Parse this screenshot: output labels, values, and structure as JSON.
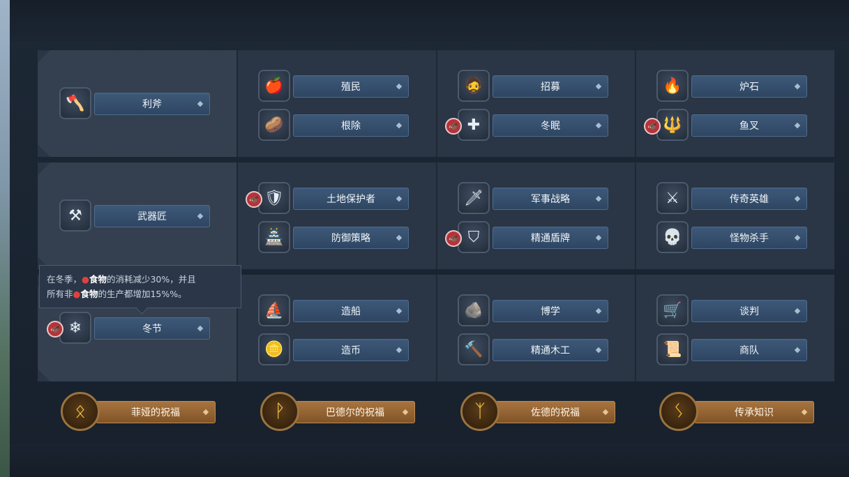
{
  "rows": [
    {
      "left": {
        "icon": "axe-icon",
        "glyph": "🪓",
        "label": "利斧",
        "badge": false
      },
      "cols": [
        [
          {
            "icon": "colonist-icon",
            "glyph": "🍎",
            "label": "殖民",
            "badge": false
          },
          {
            "icon": "uproot-icon",
            "glyph": "🥔",
            "label": "根除",
            "badge": false
          }
        ],
        [
          {
            "icon": "recruit-icon",
            "glyph": "🧔",
            "label": "招募",
            "badge": false
          },
          {
            "icon": "hibernate-icon",
            "glyph": "✚",
            "label": "冬眠",
            "badge": true
          }
        ],
        [
          {
            "icon": "hearth-icon",
            "glyph": "🔥",
            "label": "炉石",
            "badge": false
          },
          {
            "icon": "harpoon-icon",
            "glyph": "🔱",
            "label": "鱼叉",
            "badge": true
          }
        ]
      ]
    },
    {
      "left": {
        "icon": "anvil-icon",
        "glyph": "⚒",
        "label": "武器匠",
        "badge": false
      },
      "cols": [
        [
          {
            "icon": "shield-emblem-icon",
            "glyph": "🛡",
            "label": "土地保护者",
            "badge": true
          },
          {
            "icon": "watchtower-icon",
            "glyph": "🏯",
            "label": "防御策略",
            "badge": false
          }
        ],
        [
          {
            "icon": "sword-icon",
            "glyph": "🗡",
            "label": "军事战略",
            "badge": false
          },
          {
            "icon": "round-shield-icon",
            "glyph": "⛉",
            "label": "精通盾牌",
            "badge": true
          }
        ],
        [
          {
            "icon": "battle-axe-icon",
            "glyph": "⚔",
            "label": "传奇英雄",
            "badge": false
          },
          {
            "icon": "skull-icon",
            "glyph": "💀",
            "label": "怪物杀手",
            "badge": false
          }
        ]
      ]
    },
    {
      "left": {
        "icon": "snowflake-icon",
        "glyph": "❄",
        "label": "冬节",
        "badge": true
      },
      "cols": [
        [
          {
            "icon": "longship-icon",
            "glyph": "⛵",
            "label": "造船",
            "badge": false
          },
          {
            "icon": "coin-icon",
            "glyph": "🪙",
            "label": "造币",
            "badge": false
          }
        ],
        [
          {
            "icon": "rune-stone-icon",
            "glyph": "🪨",
            "label": "博学",
            "badge": false
          },
          {
            "icon": "hammer-icon",
            "glyph": "🔨",
            "label": "精通木工",
            "badge": false
          }
        ],
        [
          {
            "icon": "trade-cart-icon",
            "glyph": "🛒",
            "label": "谈判",
            "badge": false
          },
          {
            "icon": "caravan-icon",
            "glyph": "📜",
            "label": "商队",
            "badge": false
          }
        ]
      ]
    }
  ],
  "blessings": [
    {
      "icon": "rune-othala-icon",
      "glyph": "ᛟ",
      "label": "菲娅的祝福"
    },
    {
      "icon": "rune-wunjo-icon",
      "glyph": "ᚹ",
      "label": "巴德尔的祝福"
    },
    {
      "icon": "rune-algiz-icon",
      "glyph": "ᛉ",
      "label": "佐德的祝福"
    },
    {
      "icon": "rune-sowilo-icon",
      "glyph": "ᛊ",
      "label": "传承知识"
    }
  ],
  "tooltip": {
    "part1": "在冬季，",
    "food1": "食物",
    "part2": "的消耗减少30%，并且",
    "part3": "所有非",
    "food2": "食物",
    "part4": "的生产都增加15%%。"
  },
  "badge_glyph": "🐗",
  "colors": {
    "label_blue": "#3d5878",
    "blessing_gold": "#a8743f",
    "badge_red": "#b8323a"
  }
}
